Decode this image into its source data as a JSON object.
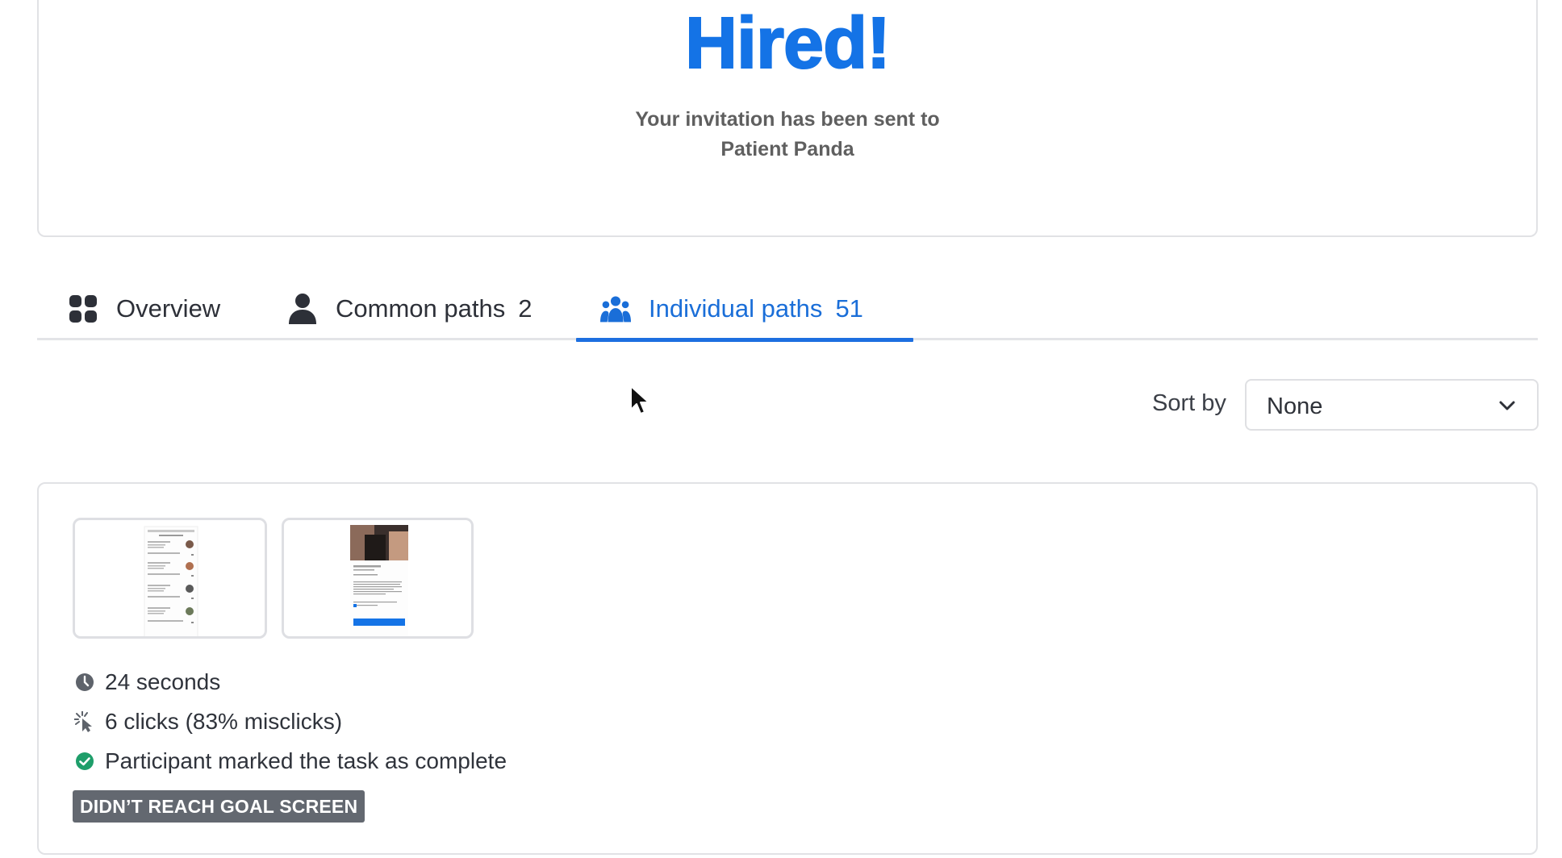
{
  "goal_screen": {
    "headline": "Hired!",
    "message": "Your invitation has been sent to Patient Panda"
  },
  "tabs": [
    {
      "label": "Overview",
      "count": "",
      "icon": "grid-icon"
    },
    {
      "label": "Common paths",
      "count": "2",
      "icon": "person-icon"
    },
    {
      "label": "Individual paths",
      "count": "51",
      "icon": "people-group-icon",
      "active": true
    }
  ],
  "sort": {
    "label": "Sort by",
    "value": "None"
  },
  "path": {
    "time": "24 seconds",
    "clicks": "6 clicks (83% misclicks)",
    "completion": "Participant marked the task as complete",
    "badge": "DIDN’T REACH GOAL SCREEN"
  },
  "colors": {
    "accent": "#1d6fe0",
    "headline": "#1473e6",
    "success": "#1e9e6a",
    "badge": "#636870"
  }
}
